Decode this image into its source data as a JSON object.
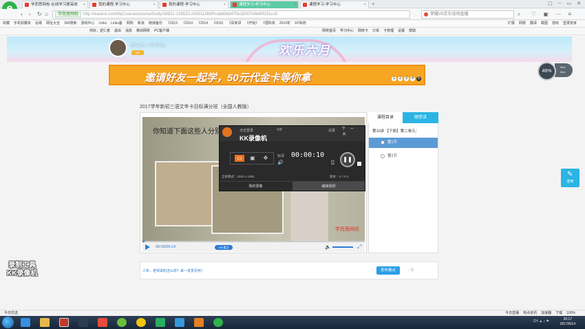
{
  "browser": {
    "tabs": [
      {
        "label": "学而思网校-在线学习更高效",
        "active": false
      },
      {
        "label": "我的课程-学习中心",
        "active": false
      },
      {
        "label": "我的课程-学习中心",
        "active": false
      },
      {
        "label": "课程学习-学习中心",
        "active": true
      },
      {
        "label": "课程学习-学习中心",
        "active": false
      }
    ],
    "site_chip": "学而思网校",
    "url": "http://xueersi.com/MyCourses/courseStudy/39821-128523-243511/880f\\cabdbb3470e18007e5b40f191cc8",
    "search_placeholder": "荣耀V9京东现场直播",
    "bookmarks": [
      "收藏",
      "手机收藏夹",
      "谷歌",
      "网址大全",
      "360搜索",
      "游戏中心",
      "Links",
      "Links备",
      "网购",
      "新浪",
      "链接备份",
      "《2013",
      "《2014",
      "《2014",
      "《2015",
      "《百家讲",
      "《开始》",
      "《理科高",
      "2014年",
      "XP系统"
    ],
    "bookmarks_right": [
      "扩展",
      "网银",
      "翻译",
      "截图",
      "游戏",
      "登录管家"
    ]
  },
  "site": {
    "topbar": [
      "你好，逆仁者",
      "退出",
      "消息",
      "移动网校",
      "PC客户端"
    ],
    "topbar_right": [
      "网校首页",
      "学习中心",
      "网校卡",
      "订单",
      "卡管理",
      "设置",
      "帮助"
    ],
    "username": "逆仁者",
    "user_center": "学习中心",
    "vip_badge": "VIP",
    "banner_title": "欢乐六月",
    "promo_text": "邀请好友一起学，50元代金卡等你拿",
    "promo_pages": [
      "1",
      "2",
      "3",
      "4",
      "5"
    ],
    "speed_percent": "46%",
    "speed_up": "0k/s",
    "speed_down": "0k/s"
  },
  "course": {
    "title": "2017学年新初三语文年卡目标满分班（全国人教版）",
    "video_subtitle": "你知道下面这些人分别",
    "video_watermark": "学而思网校",
    "time": "00:00/26:14",
    "toggle_label": "ON 看点",
    "progress_fraction": 0.01
  },
  "sidebar": {
    "tab_catalog": "课程目录",
    "tab_qa": "随堂讲",
    "lecture": "第10讲 【下册】第二单元：",
    "items": [
      "第1节",
      "第2节"
    ]
  },
  "comment": {
    "prompt": "少年，老师讲的怎么样？来一发意见吧！",
    "send_button": "发布看点",
    "likes": "0"
  },
  "float": {
    "signin": "签到"
  },
  "watermark": {
    "line1": "录制工具",
    "line2": "KK录像机"
  },
  "kk_recorder": {
    "login": "点击登录",
    "name": "KK录像机",
    "vip": "VIP",
    "settings": "设置",
    "quality": "标清",
    "timer": "00:00:10",
    "fullscreen_mode": "全屏模式：1920 x 1080",
    "version": "版本：2.7.0.2",
    "btn_my_videos": "我的录像",
    "btn_edit_video": "编辑视频"
  },
  "statusbar": {
    "left": "今日优选",
    "right": [
      "今日直播",
      "热点资讯",
      "加速器",
      "下载",
      "100%"
    ]
  },
  "taskbar": {
    "time": "20:17",
    "date": "2017/6/14",
    "lang": "CH"
  }
}
